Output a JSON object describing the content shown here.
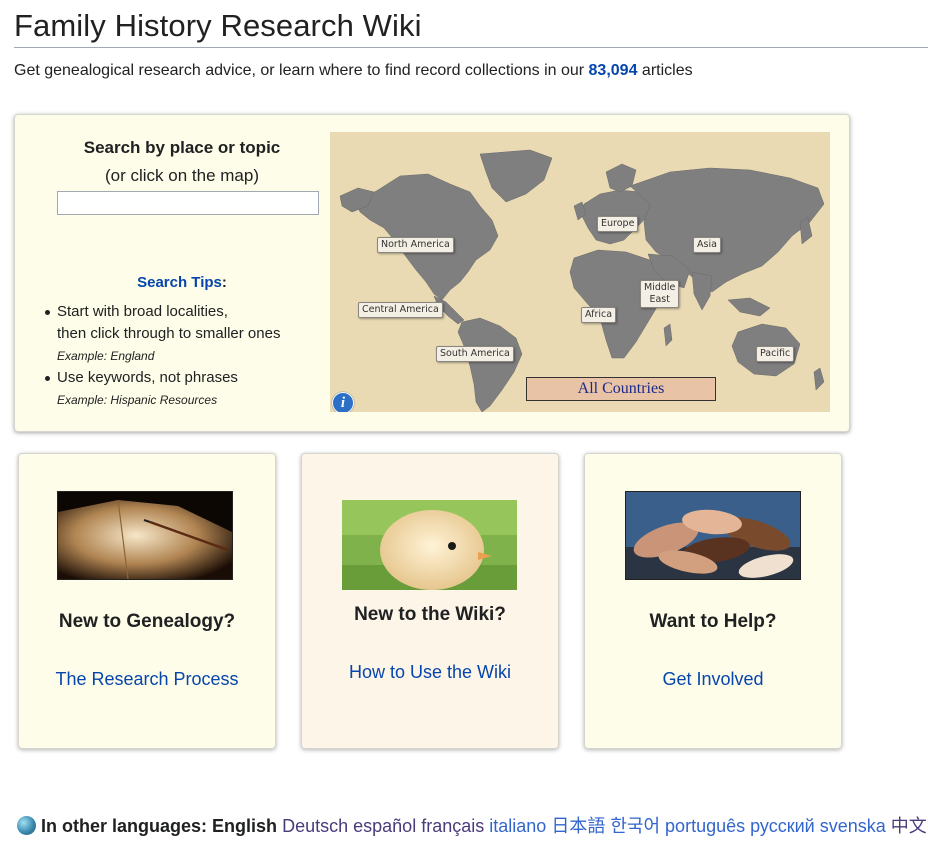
{
  "header": {
    "title": "Family History Research Wiki",
    "tagline_before": "Get genealogical research advice, or learn where to find record collections in our ",
    "article_count": "83,094",
    "tagline_after": " articles"
  },
  "search": {
    "heading": "Search by place or topic",
    "subheading": "(or click on the map)",
    "input_value": "",
    "tips_heading": "Search Tips",
    "tips_colon": ":",
    "tips": [
      {
        "line1": "Start with broad localities,",
        "line2": "then click through to smaller ones",
        "example": "Example: England"
      },
      {
        "line1": "Use keywords, not phrases",
        "example": "Example: Hispanic Resources"
      }
    ]
  },
  "map": {
    "regions": {
      "north_america": "North America",
      "central_america": "Central America",
      "south_america": "South America",
      "europe": "Europe",
      "africa": "Africa",
      "middle_east_1": "Middle",
      "middle_east_2": "East",
      "asia": "Asia",
      "pacific": "Pacific"
    },
    "all_countries": "All Countries",
    "info_icon": "i"
  },
  "cards": [
    {
      "title": "New to Genealogy?",
      "link": "The Research Process",
      "image": "book-pen-image"
    },
    {
      "title": "New to the Wiki?",
      "link": "How to Use the Wiki",
      "image": "chick-image"
    },
    {
      "title": "Want to Help?",
      "link": "Get Involved",
      "image": "hands-image"
    }
  ],
  "languages": {
    "label": "In other languages:",
    "current": "English",
    "others": [
      "Deutsch",
      "español",
      "français",
      "italiano",
      "日本語",
      "한국어",
      "português",
      "русский",
      "svenska",
      "中文"
    ]
  },
  "colors": {
    "link": "#0645ad",
    "panel_bg": "#fefde9",
    "card_alt_bg": "#fdf5e8",
    "map_bg": "#e9dcb6",
    "land": "#7f7f7f"
  }
}
